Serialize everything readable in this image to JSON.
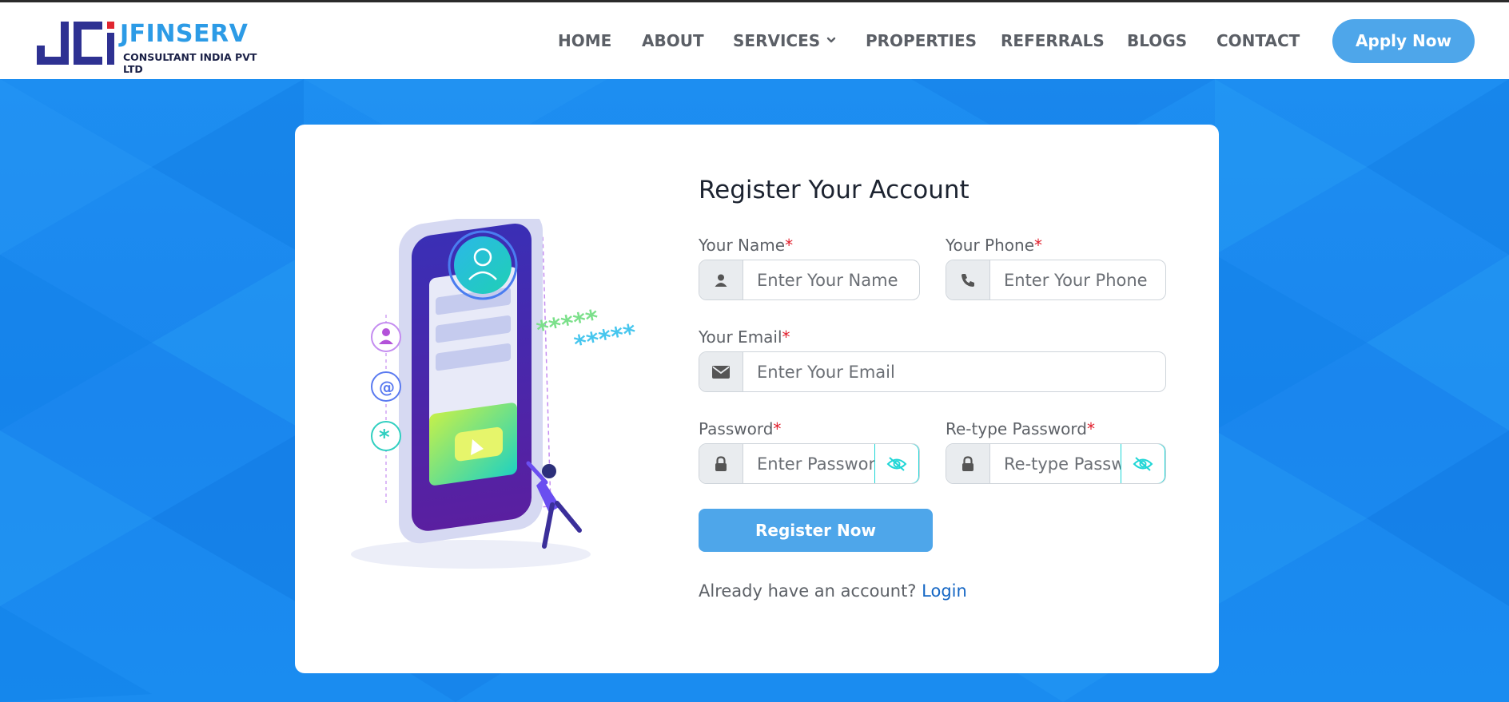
{
  "brand": {
    "name": "JFINSERV",
    "tagline": "CONSULTANT INDIA PVT LTD"
  },
  "nav": {
    "items": [
      {
        "label": "HOME"
      },
      {
        "label": "ABOUT"
      },
      {
        "label": "SERVICES",
        "has_dropdown": true
      },
      {
        "label": "PROPERTIES"
      },
      {
        "label": "REFERRALS"
      },
      {
        "label": "BLOGS"
      },
      {
        "label": "CONTACT"
      }
    ],
    "cta_label": "Apply Now"
  },
  "form": {
    "title": "Register Your Account",
    "required_marker": "*",
    "name": {
      "label": "Your Name",
      "placeholder": "Enter Your Name",
      "value": "",
      "icon": "user-icon"
    },
    "phone": {
      "label": "Your Phone",
      "placeholder": "Enter Your Phone",
      "value": "",
      "icon": "phone-icon"
    },
    "email": {
      "label": "Your Email",
      "placeholder": "Enter Your Email",
      "value": "",
      "icon": "envelope-icon"
    },
    "password": {
      "label": "Password",
      "placeholder": "Enter Password",
      "value": "",
      "icon": "lock-icon",
      "toggle_icon": "eye-slash-icon"
    },
    "retype_password": {
      "label": "Re-type Password",
      "placeholder": "Re-type Password",
      "value": "",
      "icon": "lock-icon",
      "toggle_icon": "eye-slash-icon"
    },
    "submit_label": "Register Now",
    "login_prompt": "Already have an account?",
    "login_link": "Login"
  },
  "colors": {
    "accent": "#4ea6ea",
    "brand_blue": "#2c9be6",
    "brand_navy": "#2e3192",
    "required": "#e11d2b",
    "link": "#1466c4",
    "background": "#1a8cf0",
    "eye_border": "#1fd6d6"
  }
}
